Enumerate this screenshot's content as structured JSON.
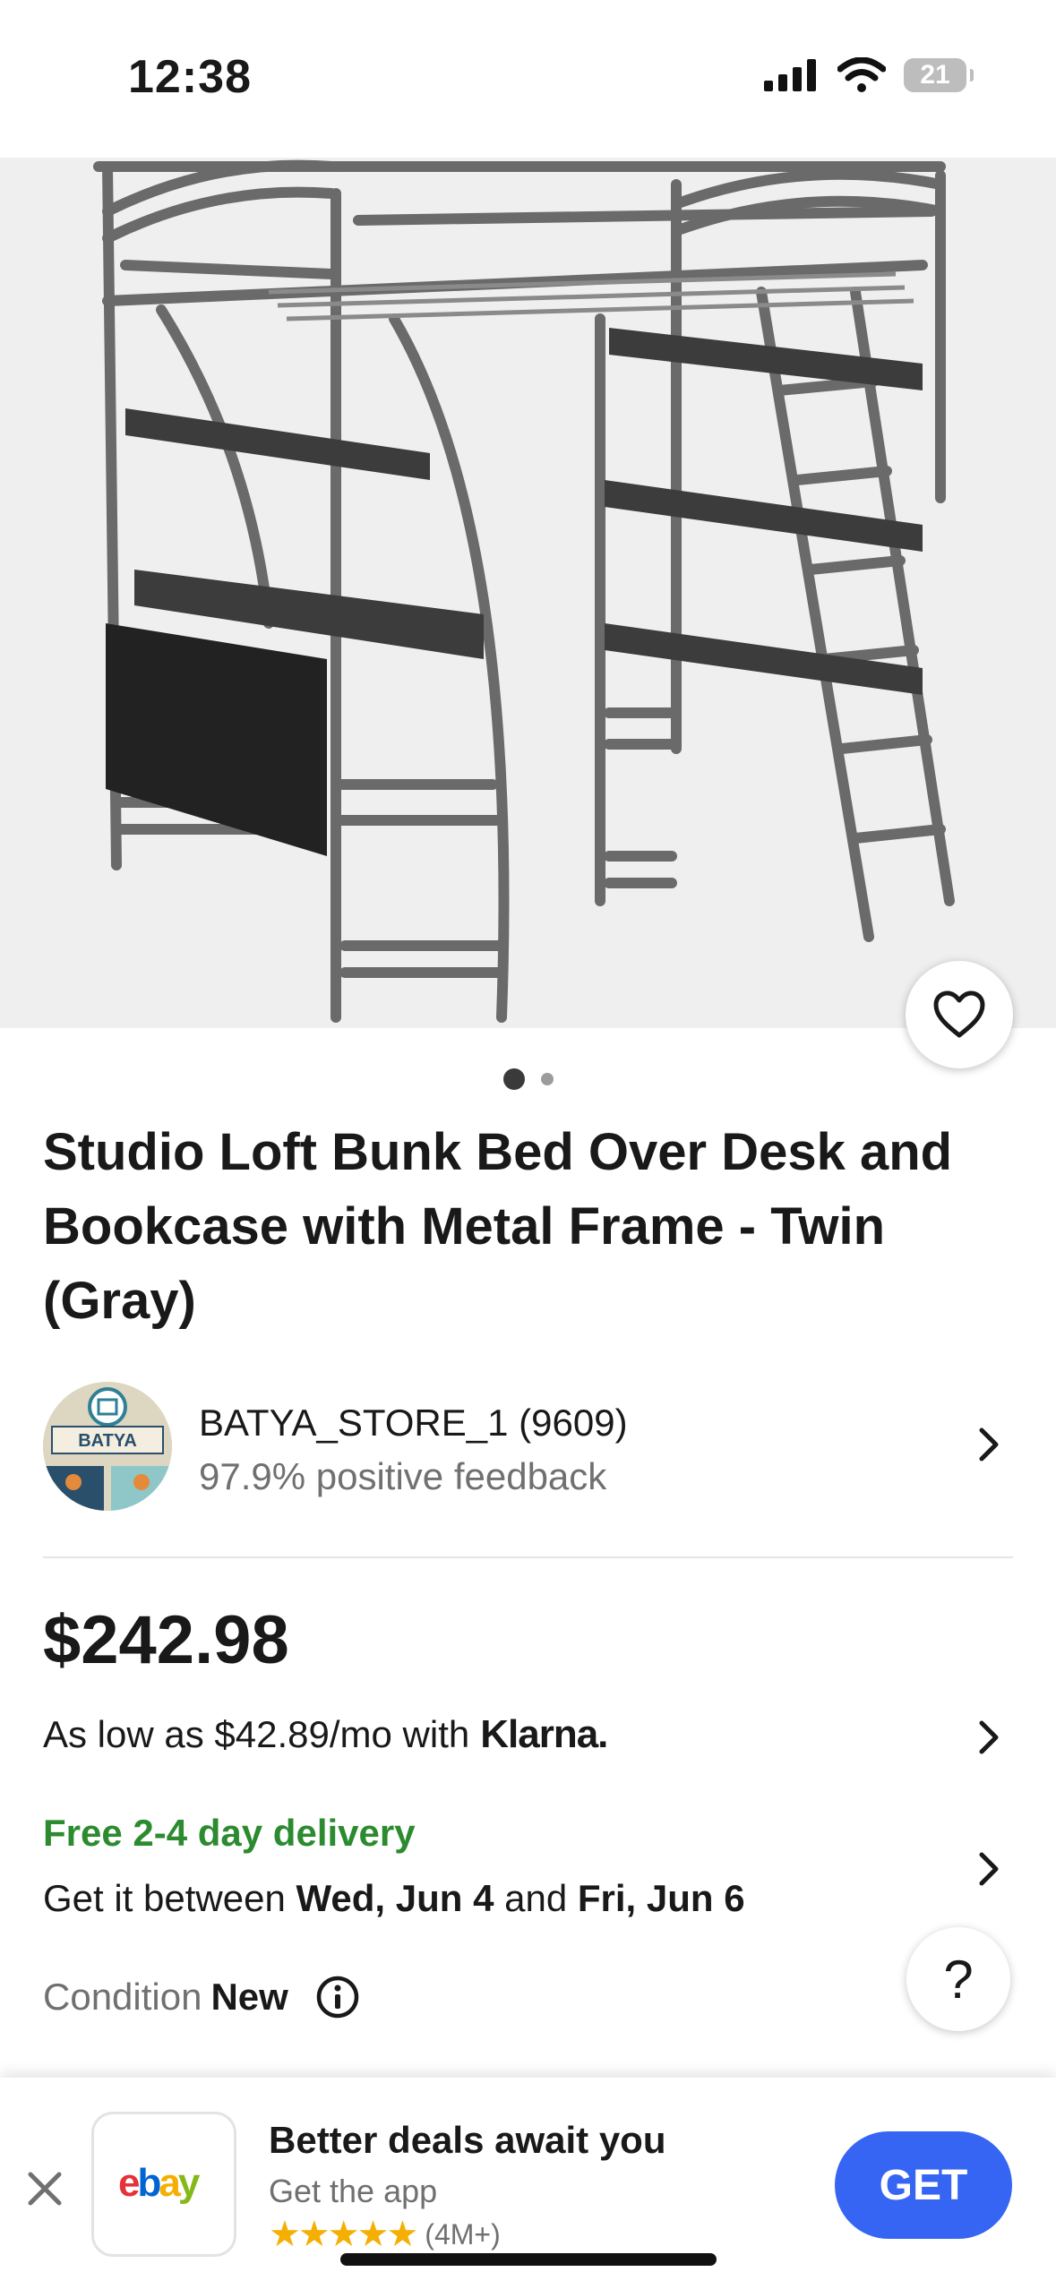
{
  "status_bar": {
    "time": "12:38",
    "battery": "21"
  },
  "product": {
    "title": "Studio Loft Bunk Bed Over Desk and Bookcase with Metal Frame - Twin (Gray)",
    "image_index": 1,
    "image_count": 2
  },
  "seller": {
    "name": "BATYA_STORE_1 (9609)",
    "feedback": "97.9% positive feedback",
    "avatar_text": "BATYA"
  },
  "pricing": {
    "price": "$242.98",
    "klarna_text": "As low as $42.89/mo with",
    "klarna_brand": "Klarna."
  },
  "delivery": {
    "title": "Free 2-4 day delivery",
    "prefix": "Get it between",
    "start": "Wed, Jun 4",
    "middle": "and",
    "end": "Fri, Jun 6"
  },
  "condition": {
    "label": "Condition",
    "value": "New"
  },
  "help": {
    "label": "?"
  },
  "app_banner": {
    "logo": "ebay",
    "title": "Better deals await you",
    "subtitle": "Get the app",
    "stars": "★★★★★",
    "rating_count": "(4M+)",
    "cta": "GET"
  },
  "colors": {
    "accent_blue": "#3665f3",
    "delivery_green": "#2c8a2f",
    "star_yellow": "#f5af02",
    "ebay_red": "#e53238",
    "ebay_blue": "#0064d2",
    "ebay_yellow": "#f5af02",
    "ebay_green": "#86b817"
  }
}
